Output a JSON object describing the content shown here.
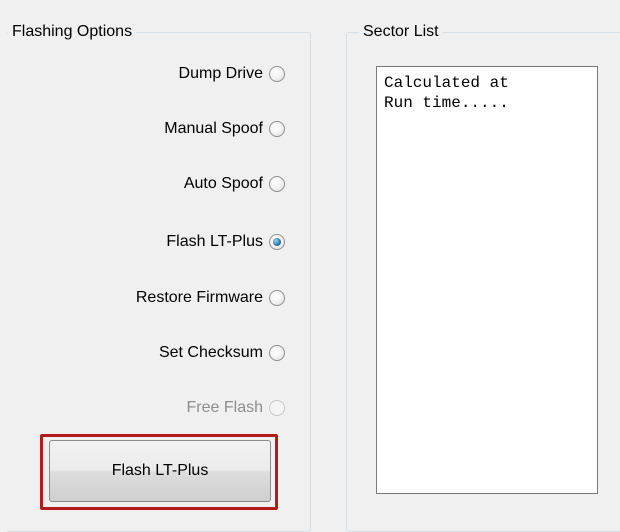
{
  "flashing_options": {
    "title": "Flashing Options",
    "options": [
      {
        "label": "Dump Drive",
        "checked": false,
        "enabled": true
      },
      {
        "label": "Manual Spoof",
        "checked": false,
        "enabled": true
      },
      {
        "label": "Auto Spoof",
        "checked": false,
        "enabled": true
      },
      {
        "label": "Flash LT-Plus",
        "checked": true,
        "enabled": true
      },
      {
        "label": "Restore Firmware",
        "checked": false,
        "enabled": true
      },
      {
        "label": "Set Checksum",
        "checked": false,
        "enabled": true
      },
      {
        "label": "Free Flash",
        "checked": false,
        "enabled": false
      }
    ],
    "action_button_label": "Flash LT-Plus",
    "highlight_color": "#b51a1a"
  },
  "sector_list": {
    "title": "Sector List",
    "text": "Calculated at\nRun time....."
  },
  "colors": {
    "window_background": "#f0f0f0",
    "radio_selected": "#2e7eb4"
  }
}
